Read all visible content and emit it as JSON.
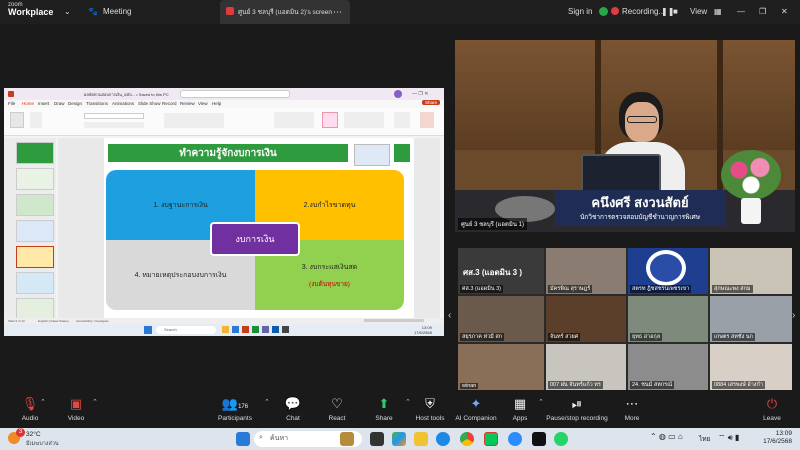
{
  "app": {
    "brand_top": "zoom",
    "brand_bottom": "Workplace",
    "meeting_label": "Meeting",
    "share_tab_title": "ศูนย์ 3 ชลบุรี (แอดมิน 2)'s screen",
    "signin_label": "Sign in",
    "recording_label": "Recording...",
    "view_label": "View"
  },
  "shared_screen": {
    "window_title": "ผลบัดทวนสอบการเงิน_ฉบับ... • Saved to this PC",
    "ribbon_tabs": [
      "File",
      "Home",
      "Insert",
      "Draw",
      "Design",
      "Transitions",
      "Animations",
      "Slide Show",
      "Record",
      "Review",
      "View",
      "Help"
    ],
    "share_button": "Share",
    "slide": {
      "title": "ทำความรู้จักงบการเงิน",
      "center_label": "งบการเงิน",
      "quadrants": [
        {
          "label": "1. งบฐานะการเงิน",
          "color": "#1ea0e0"
        },
        {
          "label": "2.งบกำไรขาดทุน",
          "color": "#ffc000"
        },
        {
          "label": "4. หมายเหตุประกอบงบการเงิน",
          "color": "#d9d9d9"
        },
        {
          "label": "3. งบกระแสเงินสด",
          "color": "#92d050"
        }
      ],
      "subnote": "(งบต้นทุนขาย)"
    },
    "status_left": "Slide 5 of 13",
    "status_lang": "English (United States)",
    "status_access": "Accessibility: Investigate",
    "search_placeholder": "Search",
    "clock": "13:09",
    "date": "17/6/2568"
  },
  "speaker": {
    "name": "คนึงศรี  สงวนสัตย์",
    "title": "นักวิชาการตรวจสอบบัญชีชำนาญการพิเศษ",
    "caption": "ศูนย์ 3 ชลบุรี (แอดมิน 1)"
  },
  "gallery": {
    "tiles": [
      {
        "name": "ศส.3 (แอดมิน 3)"
      },
      {
        "name": "มัครพิณ สุราษฎร์"
      },
      {
        "name": "สตรท ฎิชสชรนเพชรเขา"
      },
      {
        "name": "สุกษณะพง สกม"
      },
      {
        "name": "สยุรภาค ห่วมี สก"
      },
      {
        "name": "จันทร์ สวยศ"
      },
      {
        "name": "ยุทธ อ่าอกุล"
      },
      {
        "name": "เกษตร สหชัง นก"
      },
      {
        "name": "winan"
      },
      {
        "name": "007 ฝน จันทร์แก้ว ทร"
      },
      {
        "name": "24. ชนม์ สหกรณ์"
      },
      {
        "name": "0884 เสรพงษ์ อ้างกำ"
      }
    ],
    "overlay_text": "ศส.3 (แอดมิน 3 )"
  },
  "controls": {
    "audio": "Audio",
    "video": "Video",
    "participants": "Participants",
    "participants_count": "176",
    "chat": "Chat",
    "react": "React",
    "share": "Share",
    "host_tools": "Host tools",
    "ai_companion": "AI Companion",
    "apps": "Apps",
    "pause_recording": "Pause/stop recording",
    "more": "More",
    "leave": "Leave"
  },
  "taskbar": {
    "weather_temp": "32°C",
    "weather_desc": "มีเมฆบางส่วน",
    "search_placeholder": "ค้นหา",
    "lang": "ไทย",
    "time": "13:09",
    "date": "17/6/2568",
    "notif_badge": "3"
  }
}
